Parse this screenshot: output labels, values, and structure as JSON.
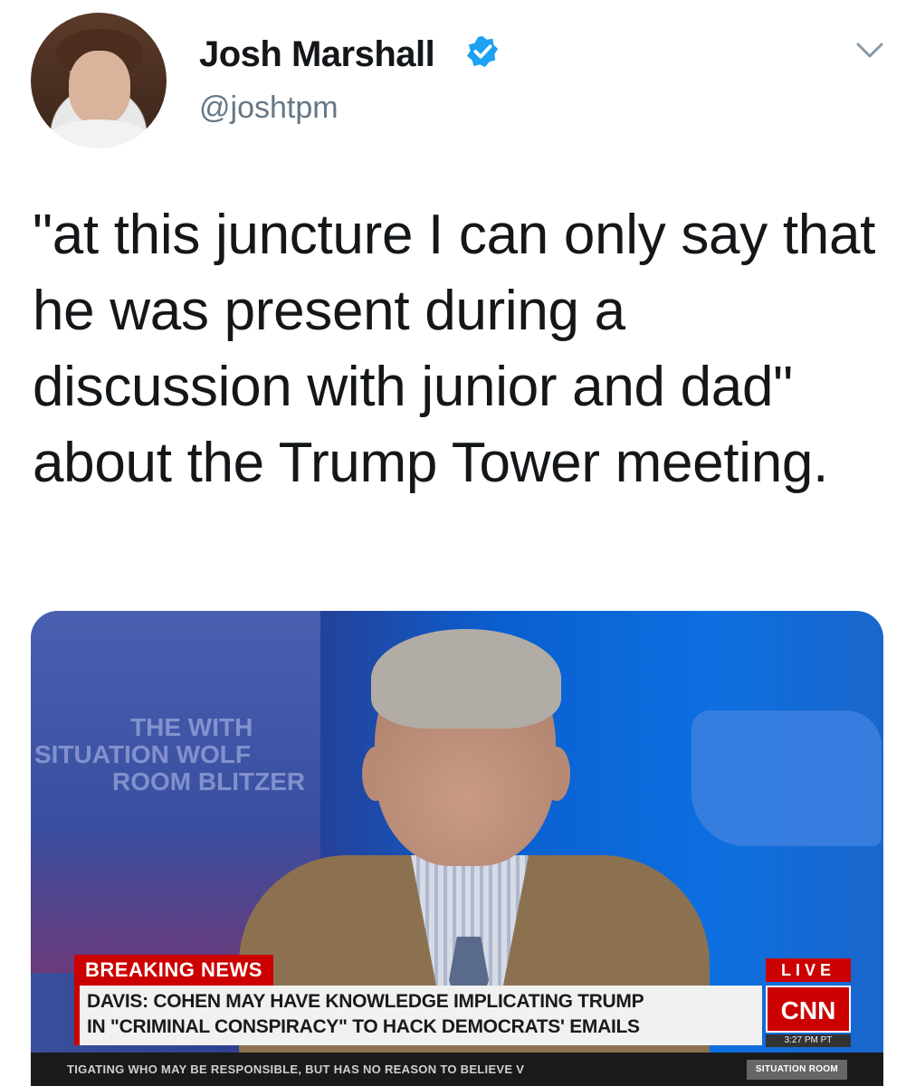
{
  "author": {
    "name": "Josh Marshall",
    "handle": "@joshtpm",
    "verified": true
  },
  "tweet": {
    "text": "\"at this juncture I can only say that he was present during a discussion with junior and dad\" about the Trump Tower meeting."
  },
  "media": {
    "breaking_label": "BREAKING NEWS",
    "live_label": "LIVE",
    "chyron_line1": "DAVIS: COHEN MAY HAVE KNOWLEDGE IMPLICATING TRUMP",
    "chyron_line2": "IN \"CRIMINAL CONSPIRACY\" TO HACK DEMOCRATS' EMAILS",
    "network_logo": "CNN",
    "time": "3:27 PM PT",
    "ticker": "TIGATING WHO MAY BE RESPONSIBLE, BUT HAS NO REASON TO BELIEVE V",
    "ticker_tag": "SITUATION ROOM",
    "wall_text_1": "THE WITH",
    "wall_text_2": "SITUATION WOLF",
    "wall_text_3": "ROOM BLITZER"
  },
  "colors": {
    "verified_blue": "#1da1f2",
    "cnn_red": "#cc0000",
    "handle_gray": "#657786"
  },
  "icons": {
    "verified": "verified-badge-icon",
    "chevron": "chevron-down-icon"
  }
}
